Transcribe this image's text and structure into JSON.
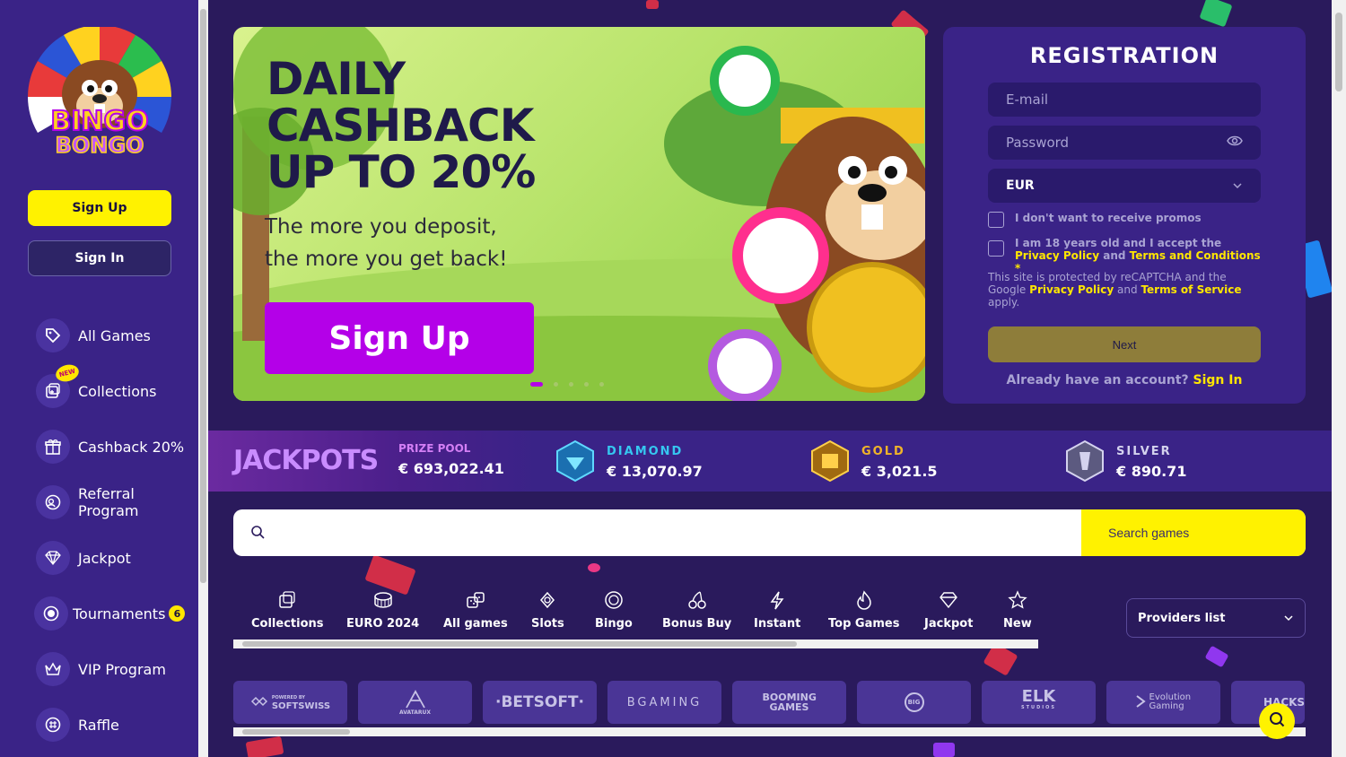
{
  "brand": {
    "name": "Bingo Bongo"
  },
  "sidebar": {
    "signup_label": "Sign Up",
    "signin_label": "Sign In",
    "items": [
      {
        "label": "All Games",
        "icon": "tag-icon"
      },
      {
        "label": "Collections",
        "icon": "collections-icon",
        "badge": "NEW"
      },
      {
        "label": "Cashback 20%",
        "icon": "gift-icon"
      },
      {
        "label": "Referral Program",
        "icon": "referral-icon"
      },
      {
        "label": "Jackpot",
        "icon": "diamond-icon"
      },
      {
        "label": "Tournaments",
        "icon": "tournament-icon",
        "count": "6"
      },
      {
        "label": "VIP Program",
        "icon": "crown-icon"
      },
      {
        "label": "Raffle",
        "icon": "raffle-icon"
      }
    ]
  },
  "banner": {
    "title": "DAILY CASHBACK UP TO 20%",
    "subtitle": "The more you deposit, the more you get back!",
    "button_label": "Sign Up",
    "slides": 5,
    "active_slide": 1
  },
  "registration": {
    "title": "REGISTRATION",
    "email_placeholder": "E-mail",
    "password_placeholder": "Password",
    "currency": "EUR",
    "promo_label": "I don't want to receive promos",
    "age_prefix": "I am 18 years old and I accept the",
    "privacy_policy": "Privacy Policy",
    "and": "and",
    "terms": "Terms and Conditions",
    "required_mark": "*",
    "recaptcha_prefix": "This site is protected by reCAPTCHA and the Google",
    "recaptcha_privacy": "Privacy Policy",
    "recaptcha_and": "and",
    "recaptcha_terms": "Terms of Service",
    "recaptcha_suffix": "apply.",
    "next_label": "Next",
    "already_text": "Already have an account?",
    "signin_link": "Sign In"
  },
  "jackpots": {
    "title": "JACKPOTS",
    "prize_pool_label": "PRIZE POOL",
    "prize_pool_value": "€ 693,022.41",
    "tiers": [
      {
        "name": "DIAMOND",
        "value": "€ 13,070.97",
        "color": "#35c7f0"
      },
      {
        "name": "GOLD",
        "value": "€ 3,021.5",
        "color": "#f0b428"
      },
      {
        "name": "SILVER",
        "value": "€ 890.71",
        "color": "#b9b6d8"
      }
    ]
  },
  "search": {
    "placeholder": "",
    "button_label": "Search games"
  },
  "categories": [
    {
      "label": "Collections",
      "icon": "collections-icon"
    },
    {
      "label": "EURO 2024",
      "icon": "stadium-icon"
    },
    {
      "label": "All games",
      "icon": "dice-icon"
    },
    {
      "label": "Slots",
      "icon": "slots-icon"
    },
    {
      "label": "Bingo",
      "icon": "bingo-icon"
    },
    {
      "label": "Bonus Buy",
      "icon": "cherry-icon"
    },
    {
      "label": "Instant",
      "icon": "lightning-icon"
    },
    {
      "label": "Top Games",
      "icon": "flame-icon"
    },
    {
      "label": "Jackpot",
      "icon": "diamond-icon"
    },
    {
      "label": "New",
      "icon": "star-icon"
    }
  ],
  "providers_dropdown": "Providers list",
  "providers": [
    {
      "name": "SOFTSWISS",
      "caption": "POWERED BY"
    },
    {
      "name": "AVATARUX"
    },
    {
      "name": "·BETSOFT·"
    },
    {
      "name": "BGAMING"
    },
    {
      "name": "BOOMING GAMES"
    },
    {
      "name": "BIG"
    },
    {
      "name": "ELK",
      "caption": "STUDIOS"
    },
    {
      "name": "Evolution Gaming"
    },
    {
      "name": "HACKSAW"
    }
  ],
  "colors": {
    "sidebar": "#3a2387",
    "background": "#2a1a5c",
    "accent_yellow": "#fff200",
    "accent_purple": "#b400e8"
  }
}
